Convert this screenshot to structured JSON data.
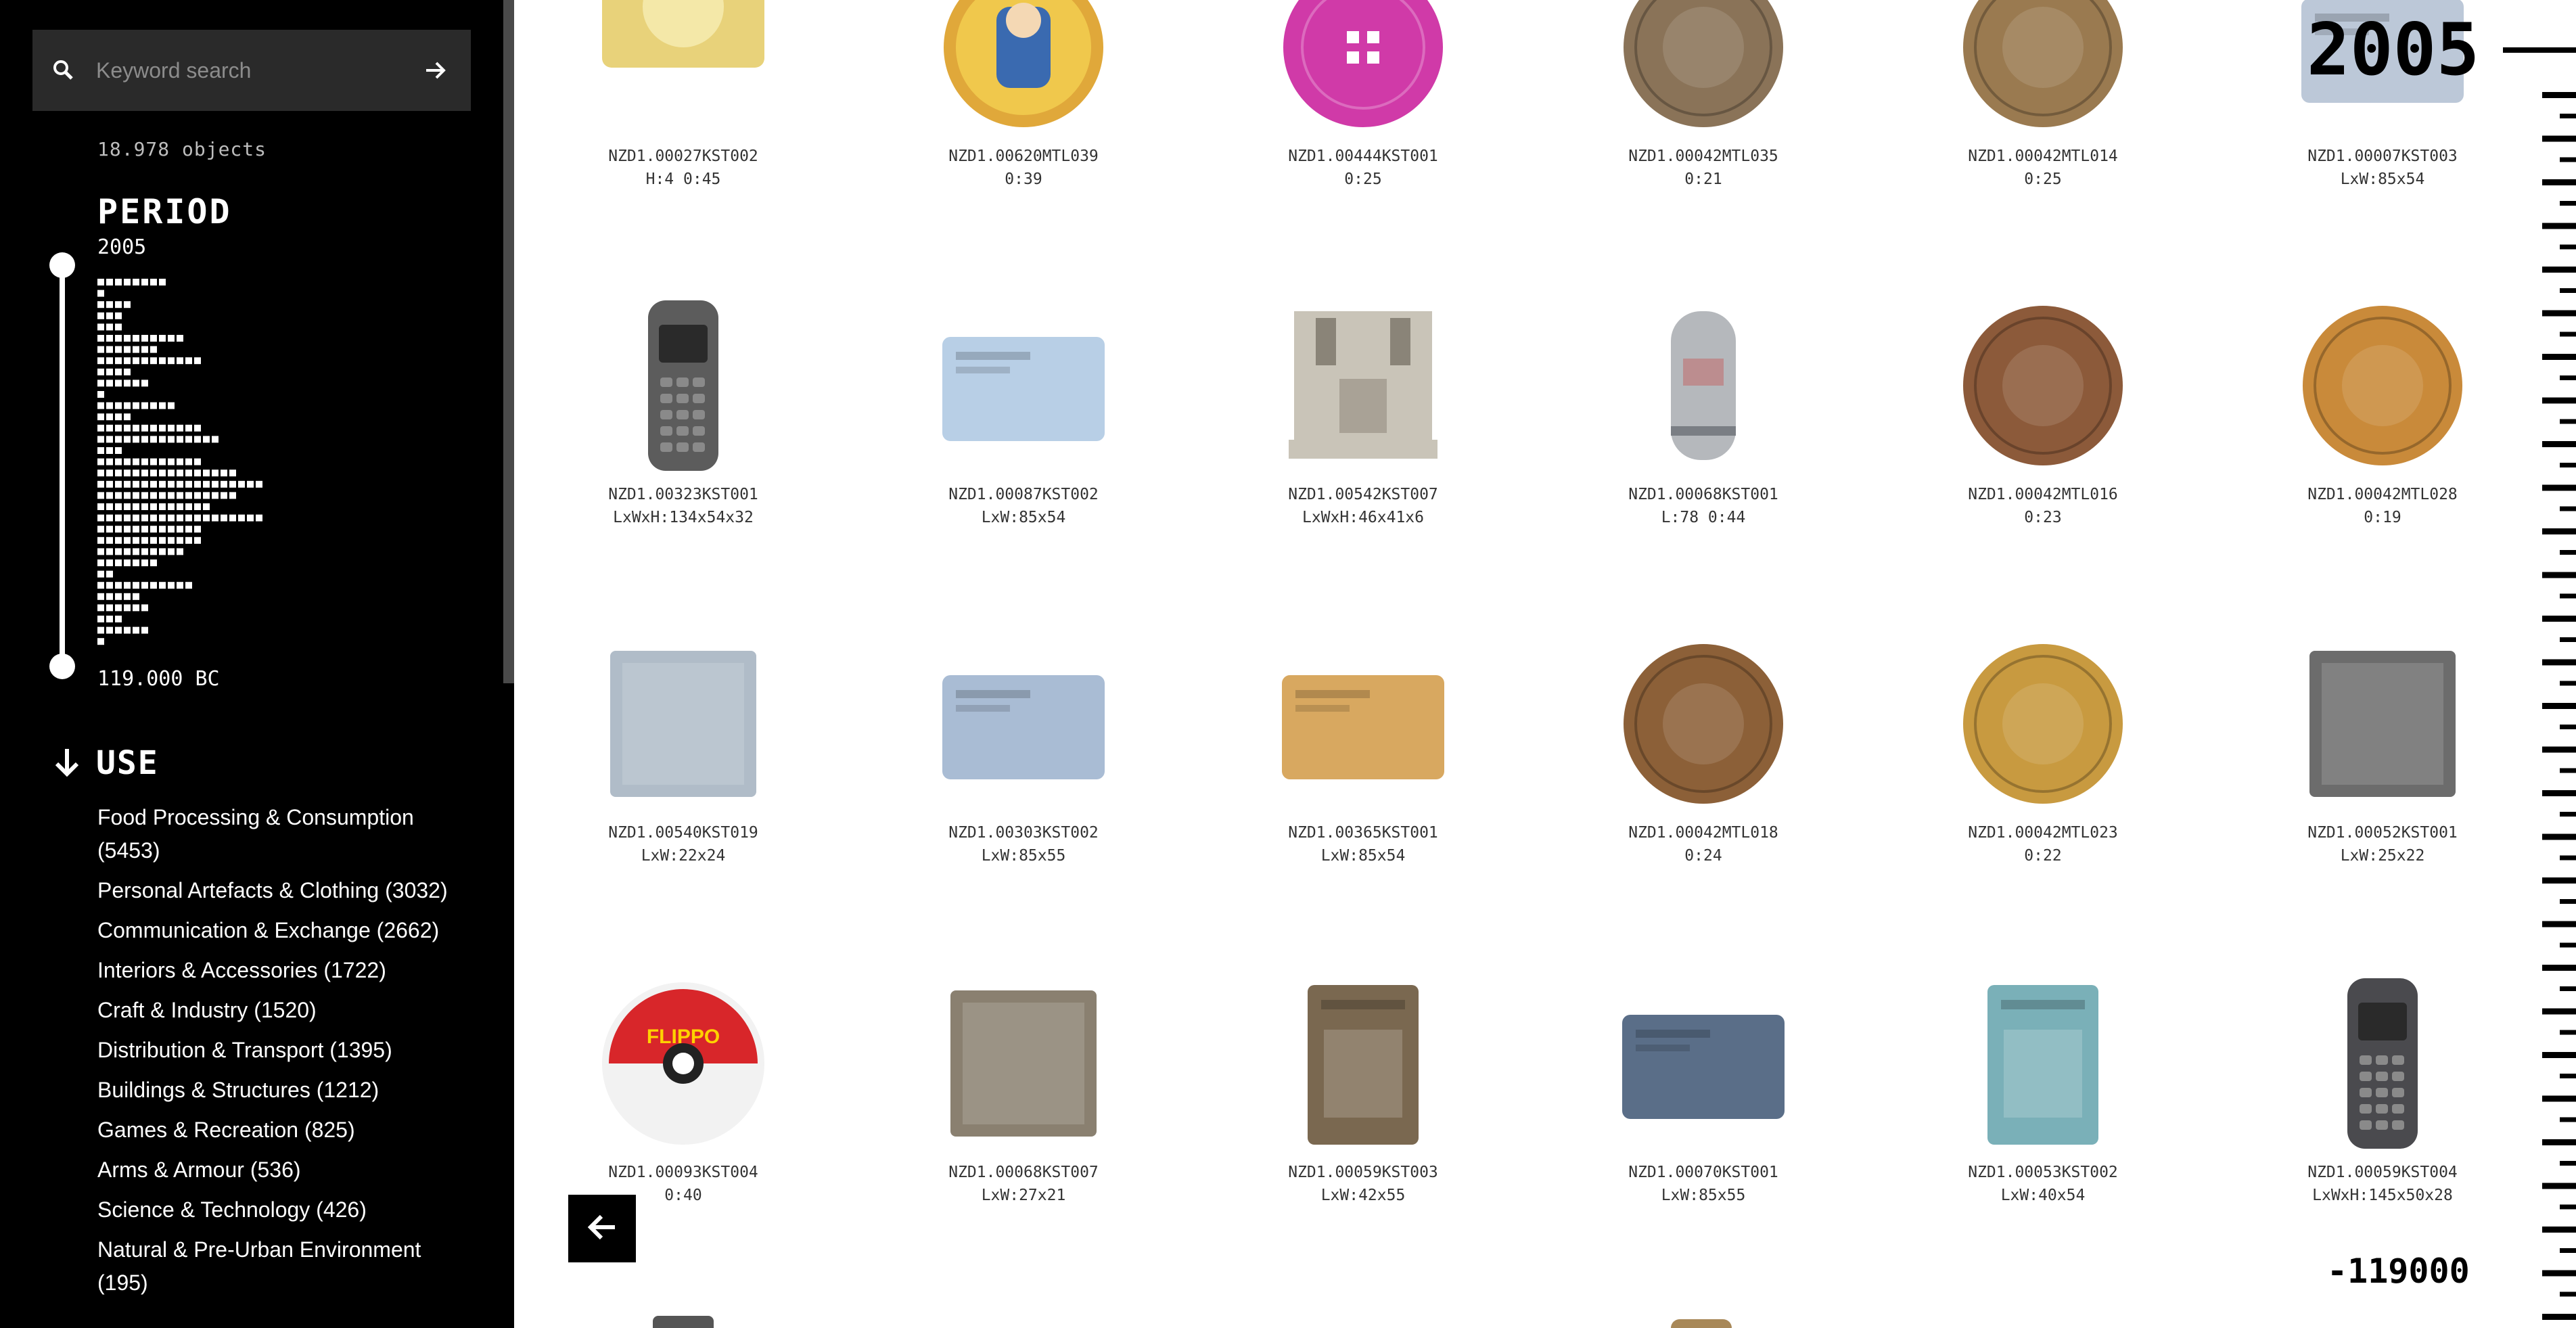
{
  "search": {
    "placeholder": "Keyword search",
    "search_icon": "search-icon",
    "submit_icon": "arrow-right-icon"
  },
  "object_count": "18.978 objects",
  "period": {
    "title": "PERIOD",
    "top_label": "2005",
    "bottom_label": "119.000 BC",
    "histogram_widths": [
      8,
      0,
      4,
      3,
      3,
      10,
      7,
      12,
      4,
      6,
      0,
      9,
      4,
      12,
      14,
      3,
      12,
      16,
      19,
      16,
      13,
      19,
      12,
      12,
      10,
      7,
      2,
      11,
      5,
      6,
      3,
      6,
      1
    ]
  },
  "use": {
    "title": "USE",
    "icon": "arrow-down-icon",
    "categories": [
      {
        "label": "Food Processing & Consumption (5453)"
      },
      {
        "label": "Personal Artefacts & Clothing (3032)"
      },
      {
        "label": "Communication & Exchange (2662)"
      },
      {
        "label": "Interiors & Accessories (1722)"
      },
      {
        "label": "Craft & Industry (1520)"
      },
      {
        "label": "Distribution & Transport (1395)"
      },
      {
        "label": "Buildings & Structures (1212)"
      },
      {
        "label": "Games & Recreation (825)"
      },
      {
        "label": "Arms & Armour (536)"
      },
      {
        "label": "Science & Technology (426)"
      },
      {
        "label": "Natural & Pre-Urban Environment (195)"
      }
    ]
  },
  "items": [
    {
      "code": "NZD1.00027KST002",
      "dims": "H:4 0:45",
      "kind": "packet",
      "color": "#e8d27a"
    },
    {
      "code": "NZD1.00620MTL039",
      "dims": "0:39",
      "kind": "tazo",
      "color": "#e0a83a"
    },
    {
      "code": "NZD1.00444KST001",
      "dims": "0:25",
      "kind": "button",
      "color": "#d03aa8"
    },
    {
      "code": "NZD1.00042MTL035",
      "dims": "0:21",
      "kind": "coin",
      "color": "#8a7358"
    },
    {
      "code": "NZD1.00042MTL014",
      "dims": "0:25",
      "kind": "coin",
      "color": "#9a7a50"
    },
    {
      "code": "NZD1.00007KST003",
      "dims": "LxW:85x54",
      "kind": "card",
      "color": "#bcc8d8"
    },
    {
      "code": "NZD1.00323KST001",
      "dims": "LxWxH:134x54x32",
      "kind": "phone",
      "color": "#5c5c5c"
    },
    {
      "code": "NZD1.00087KST002",
      "dims": "LxW:85x54",
      "kind": "card",
      "color": "#b8cfe6"
    },
    {
      "code": "NZD1.00542KST007",
      "dims": "LxWxH:46x41x6",
      "kind": "clamp",
      "color": "#c9c4b8"
    },
    {
      "code": "NZD1.00068KST001",
      "dims": "L:78 0:44",
      "kind": "canister",
      "color": "#b5b8bc"
    },
    {
      "code": "NZD1.00042MTL016",
      "dims": "0:23",
      "kind": "coin",
      "color": "#8c5a3a"
    },
    {
      "code": "NZD1.00042MTL028",
      "dims": "0:19",
      "kind": "coin",
      "color": "#c98a3a"
    },
    {
      "code": "NZD1.00540KST019",
      "dims": "LxW:22x24",
      "kind": "square",
      "color": "#b0bcc8"
    },
    {
      "code": "NZD1.00303KST002",
      "dims": "LxW:85x55",
      "kind": "card",
      "color": "#a9bcd4"
    },
    {
      "code": "NZD1.00365KST001",
      "dims": "LxW:85x54",
      "kind": "card",
      "color": "#d8a860"
    },
    {
      "code": "NZD1.00042MTL018",
      "dims": "0:24",
      "kind": "coin",
      "color": "#8c6038"
    },
    {
      "code": "NZD1.00042MTL023",
      "dims": "0:22",
      "kind": "coin",
      "color": "#c89a40"
    },
    {
      "code": "NZD1.00052KST001",
      "dims": "LxW:25x22",
      "kind": "square",
      "color": "#6c6c6c"
    },
    {
      "code": "NZD1.00093KST004",
      "dims": "0:40",
      "kind": "tazo-red",
      "color": "#d8262a"
    },
    {
      "code": "NZD1.00068KST007",
      "dims": "LxW:27x21",
      "kind": "square",
      "color": "#8a8070"
    },
    {
      "code": "NZD1.00059KST003",
      "dims": "LxW:42x55",
      "kind": "tall-card",
      "color": "#7a6850"
    },
    {
      "code": "NZD1.00070KST001",
      "dims": "LxW:85x55",
      "kind": "card",
      "color": "#5a6e88"
    },
    {
      "code": "NZD1.00053KST002",
      "dims": "LxW:40x54",
      "kind": "tall-card",
      "color": "#7ab0b8"
    },
    {
      "code": "NZD1.00059KST004",
      "dims": "LxWxH:145x50x28",
      "kind": "phone",
      "color": "#4a4a4e"
    }
  ],
  "timeline": {
    "top_label": "2005",
    "bottom_label": "-119000"
  },
  "back_button_icon": "arrow-left-icon"
}
